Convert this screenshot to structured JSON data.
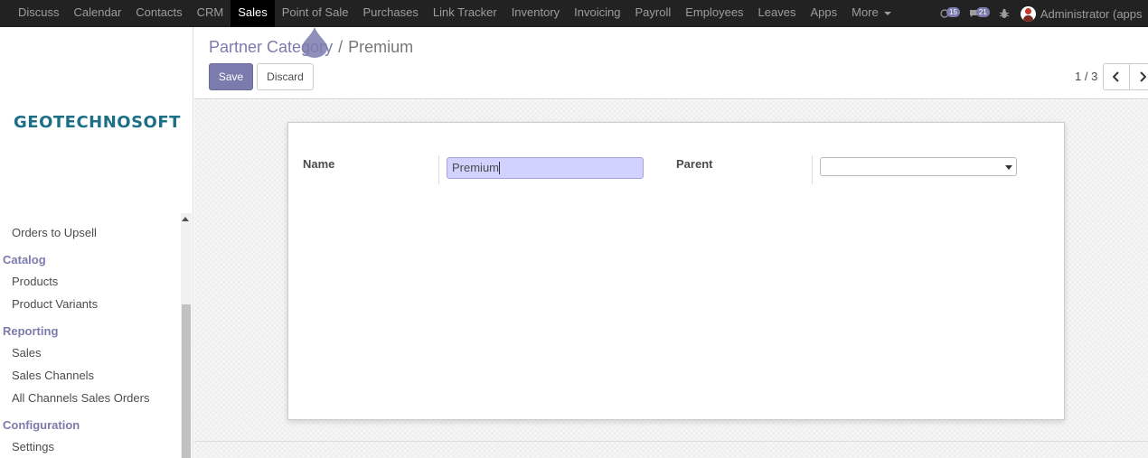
{
  "topbar": {
    "menu": [
      "Discuss",
      "Calendar",
      "Contacts",
      "CRM",
      "Sales",
      "Point of Sale",
      "Purchases",
      "Link Tracker",
      "Inventory",
      "Invoicing",
      "Payroll",
      "Employees",
      "Leaves",
      "Apps",
      "More"
    ],
    "active": "Sales",
    "activities_count": "15",
    "messages_count": "21",
    "user_name": "Administrator (apps"
  },
  "sidebar": {
    "logo": "GEOTECHNOSOFT",
    "items": [
      {
        "type": "item",
        "label": "Orders to Upsell"
      },
      {
        "type": "section",
        "label": "Catalog"
      },
      {
        "type": "item",
        "label": "Products"
      },
      {
        "type": "item",
        "label": "Product Variants"
      },
      {
        "type": "section",
        "label": "Reporting"
      },
      {
        "type": "item",
        "label": "Sales"
      },
      {
        "type": "item",
        "label": "Sales Channels"
      },
      {
        "type": "item",
        "label": "All Channels Sales Orders"
      },
      {
        "type": "section",
        "label": "Configuration"
      },
      {
        "type": "item",
        "label": "Settings"
      }
    ]
  },
  "control": {
    "breadcrumb_parent": "Partner Category",
    "breadcrumb_sep": "/",
    "breadcrumb_current": "Premium",
    "save_label": "Save",
    "discard_label": "Discard",
    "pager": "1 / 3"
  },
  "form": {
    "name_label": "Name",
    "name_value": "Premium",
    "parent_label": "Parent",
    "parent_value": ""
  },
  "colors": {
    "brand": "#7c7bad",
    "navbar": "#222222",
    "logo": "#1c6f86",
    "input_highlight": "#d2d2ff"
  }
}
